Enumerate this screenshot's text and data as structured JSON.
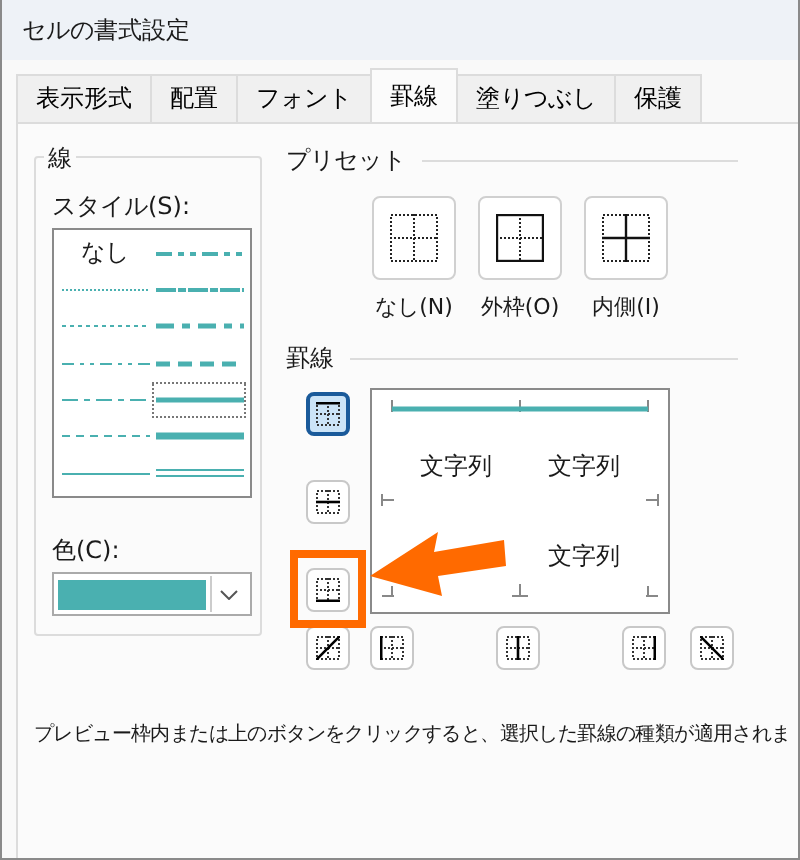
{
  "window": {
    "title": "セルの書式設定"
  },
  "tabs": [
    {
      "label": "表示形式",
      "selected": false
    },
    {
      "label": "配置",
      "selected": false
    },
    {
      "label": "フォント",
      "selected": false
    },
    {
      "label": "罫線",
      "selected": true
    },
    {
      "label": "塗りつぶし",
      "selected": false
    },
    {
      "label": "保護",
      "selected": false
    }
  ],
  "line": {
    "label": "線",
    "style_label": "スタイル(S):",
    "styles": [
      {
        "kind": "none",
        "label": "なし",
        "selected": false
      },
      {
        "kind": "hair",
        "selected": false
      },
      {
        "kind": "dotted",
        "selected": false
      },
      {
        "kind": "dashdotdot",
        "selected": false
      },
      {
        "kind": "dashdot",
        "selected": false
      },
      {
        "kind": "dashed",
        "selected": false
      },
      {
        "kind": "thin",
        "selected": false
      },
      {
        "kind": "mediumdashdotdot",
        "selected": false
      },
      {
        "kind": "slanted",
        "selected": false
      },
      {
        "kind": "mediumdashdot",
        "selected": false
      },
      {
        "kind": "mediumdashed",
        "selected": false
      },
      {
        "kind": "medium",
        "selected": true
      },
      {
        "kind": "thick",
        "selected": false
      },
      {
        "kind": "double",
        "selected": false
      }
    ],
    "color_label": "色(C):",
    "color": "#4ab0b0"
  },
  "preset": {
    "label": "プリセット",
    "buttons": [
      {
        "kind": "none",
        "label": "なし(N)"
      },
      {
        "kind": "outline",
        "label": "外枠(O)"
      },
      {
        "kind": "inside",
        "label": "内側(I)"
      }
    ]
  },
  "border": {
    "label": "罫線",
    "preview_texts": [
      "文字列",
      "文字列",
      "文字列"
    ],
    "buttons": [
      {
        "kind": "top",
        "selected": true
      },
      {
        "kind": "middle",
        "selected": false
      },
      {
        "kind": "bottom",
        "selected": false
      },
      {
        "kind": "diagup",
        "selected": false
      },
      {
        "kind": "left",
        "selected": false
      },
      {
        "kind": "center",
        "selected": false
      },
      {
        "kind": "right",
        "selected": false
      },
      {
        "kind": "diagdown",
        "selected": false
      }
    ]
  },
  "hint": "プレビュー枠内または上のボタンをクリックすると、選択した罫線の種類が適用されま"
}
